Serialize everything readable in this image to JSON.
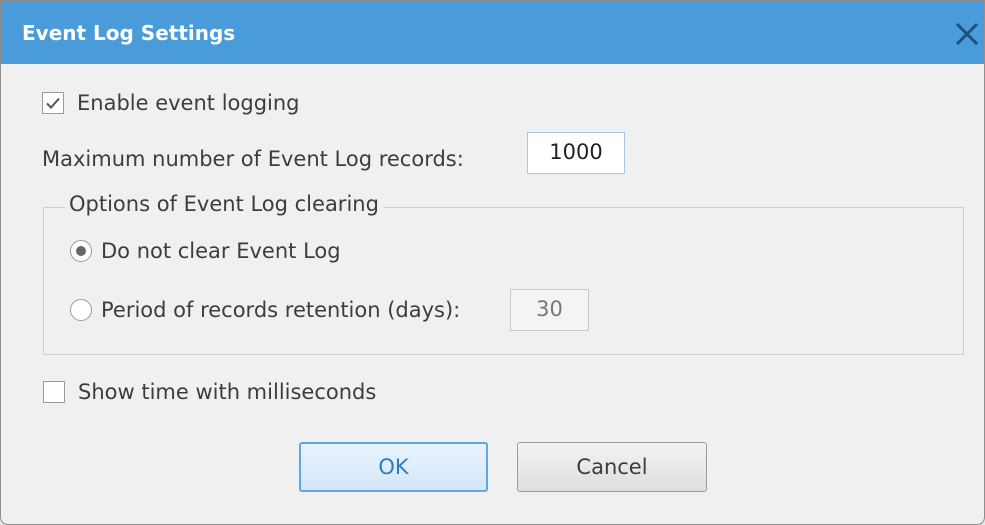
{
  "dialog": {
    "title": "Event Log Settings",
    "close_icon": "close-icon",
    "accent_color": "#4a9bda"
  },
  "enable_logging": {
    "label": "Enable event logging",
    "checked": true
  },
  "max_records": {
    "label": "Maximum number of Event Log records:",
    "value": "1000"
  },
  "clearing_group": {
    "title": "Options of Event Log clearing",
    "options": [
      {
        "label": "Do not clear Event Log",
        "selected": true
      },
      {
        "label": "Period of records retention (days):",
        "selected": false
      }
    ],
    "retention_days": "30"
  },
  "show_milliseconds": {
    "label": "Show time with milliseconds",
    "checked": false
  },
  "buttons": {
    "ok": "OK",
    "cancel": "Cancel"
  }
}
